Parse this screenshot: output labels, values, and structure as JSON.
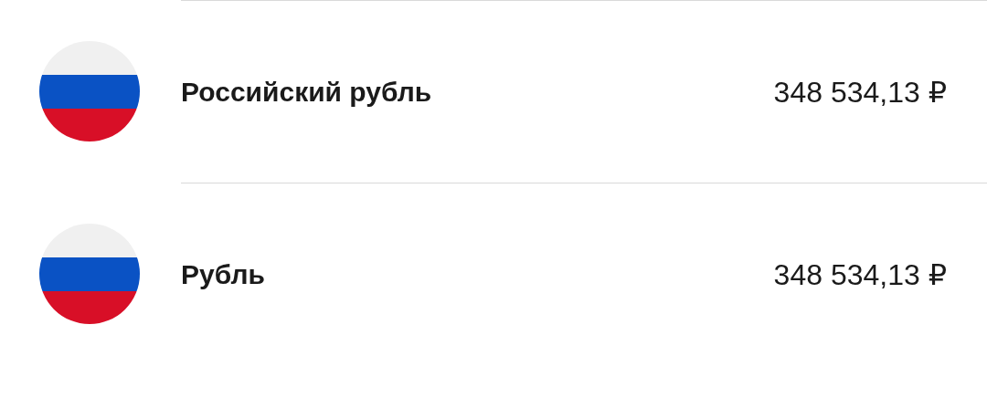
{
  "accounts": [
    {
      "name": "Российский рубль",
      "amount": "348 534,13 ₽"
    },
    {
      "name": "Рубль",
      "amount": "348 534,13 ₽"
    }
  ]
}
